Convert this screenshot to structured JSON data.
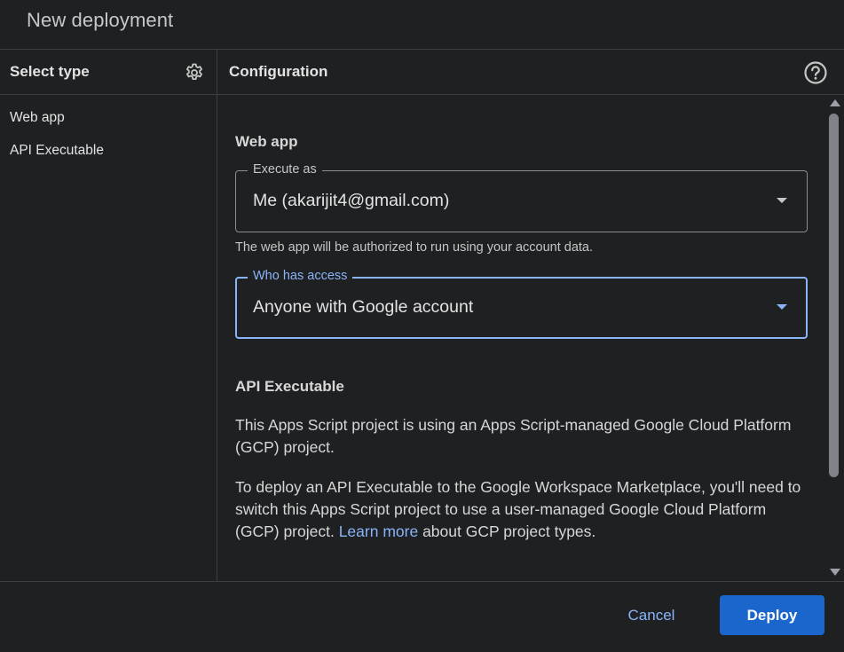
{
  "dialog": {
    "title": "New deployment"
  },
  "select_type": {
    "title": "Select type",
    "items": [
      {
        "label": "Web app"
      },
      {
        "label": "API Executable"
      }
    ]
  },
  "configuration": {
    "title": "Configuration",
    "web_app": {
      "section_title": "Web app",
      "execute_as": {
        "label": "Execute as",
        "value": "Me (akarijit4@gmail.com)"
      },
      "execute_as_helper": "The web app will be authorized to run using your account data.",
      "who_has_access": {
        "label": "Who has access",
        "value": "Anyone with Google account"
      }
    },
    "api_executable": {
      "section_title": "API Executable",
      "paragraph1": "This Apps Script project is using an Apps Script-managed Google Cloud Platform (GCP) project.",
      "paragraph2_before": "To deploy an API Executable to the Google Workspace Marketplace, you'll need to switch this Apps Script project to use a user-managed Google Cloud Platform (GCP) project. ",
      "paragraph2_link": "Learn more",
      "paragraph2_after": " about GCP project types."
    }
  },
  "footer": {
    "cancel_label": "Cancel",
    "deploy_label": "Deploy"
  },
  "colors": {
    "background": "#1f2022",
    "accent": "#8ab4f8",
    "primary_button": "#1a66cc",
    "divider": "#3c4043"
  }
}
